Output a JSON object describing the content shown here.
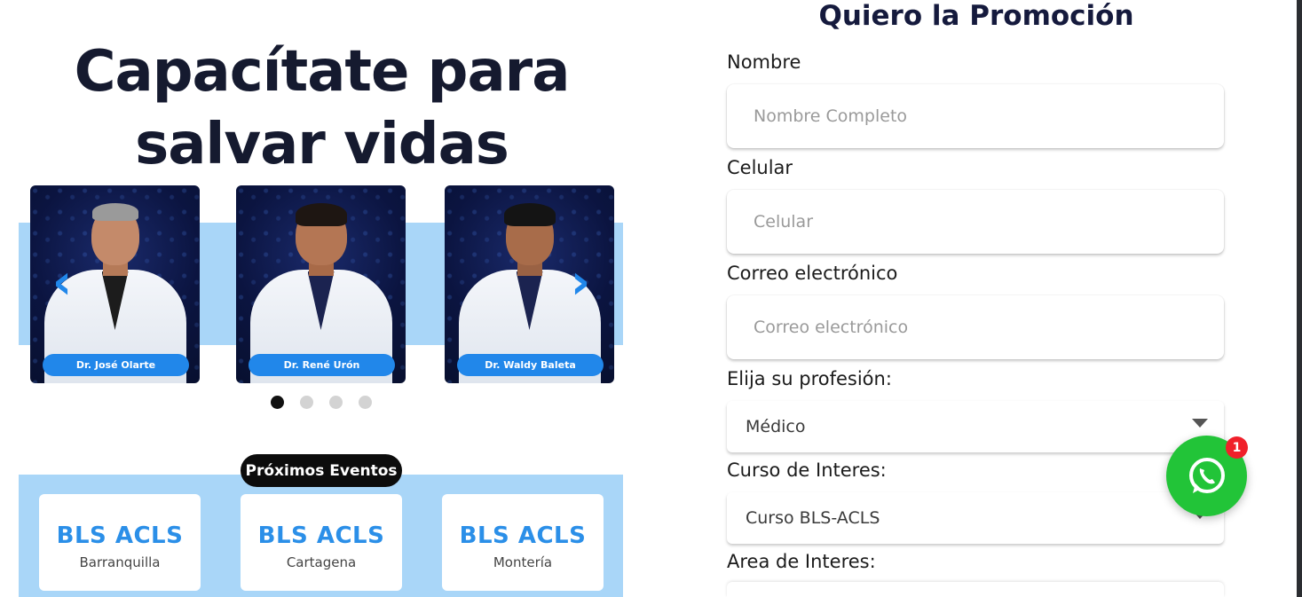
{
  "hero": {
    "line1": "Capacítate para",
    "line2": "salvar vidas"
  },
  "carousel": {
    "prev_icon": "chevron-left-icon",
    "next_icon": "chevron-right-icon",
    "slides": [
      {
        "name": "Dr. José Olarte"
      },
      {
        "name": "Dr. René Urón"
      },
      {
        "name": "Dr. Waldy Baleta"
      }
    ],
    "pagination": {
      "count": 4,
      "active": 0
    }
  },
  "events": {
    "heading": "Próximos Eventos",
    "items": [
      {
        "title": "BLS ACLS",
        "city": "Barranquilla"
      },
      {
        "title": "BLS ACLS",
        "city": "Cartagena"
      },
      {
        "title": "BLS ACLS",
        "city": "Montería"
      }
    ]
  },
  "form": {
    "title": "Quiero la Promoción",
    "name_label": "Nombre",
    "name_placeholder": "Nombre Completo",
    "phone_label": "Celular",
    "phone_placeholder": "Celular",
    "email_label": "Correo electrónico",
    "email_placeholder": "Correo electrónico",
    "profession_label": "Elija su profesión:",
    "profession_value": "Médico",
    "course_label": "Curso de Interes:",
    "course_value": "Curso BLS-ACLS",
    "area_label": "Area de Interes:"
  },
  "whatsapp": {
    "icon": "whatsapp-icon",
    "badge": "1",
    "color": "#22c438"
  },
  "colors": {
    "accent": "#2187ea",
    "band": "#a9d6f8",
    "title": "#151a2f"
  }
}
